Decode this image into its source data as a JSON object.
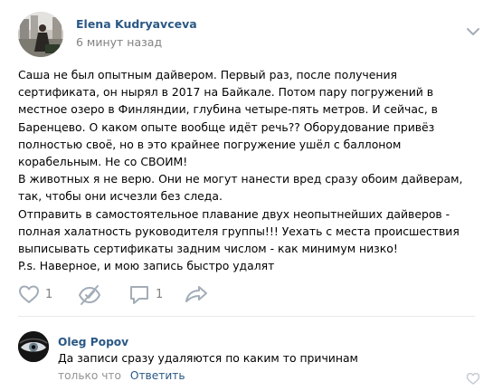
{
  "post": {
    "author": "Elena Kudryavceva",
    "time": "6 минут назад",
    "paragraphs": [
      "Саша не был опытным дайвером. Первый раз, после получения сертификата, он нырял в 2017 на Байкале. Потом пару погружений в местное озеро в Финляндии, глубина четыре-пять метров. И сейчас, в Баренцево. О каком опыте вообще идёт речь?? Оборудование привёз полностью своё, но в это крайнее погружение ушёл с баллоном корабельным. Не со СВОИМ!",
      "В животных я не верю. Они не могут нанести вред сразу обоим дайверам, так, чтобы они исчезли без следа.",
      "Отправить в самостоятельное плавание двух неопытнейших дайверов - полная халатность руководителя группы!!! Уехать с места происшествия выписывать сертификаты задним числом - как минимум низко!",
      "P.s. Наверное, и мою запись быстро удалят"
    ],
    "likes": "1",
    "comments": "1"
  },
  "comment": {
    "author": "Oleg Popov",
    "text": "Да записи сразу удаляются по каким то причинам",
    "time": "только что",
    "reply_label": "Ответить"
  },
  "icons": {
    "more": "chevron-down-icon",
    "like": "heart-outline-icon",
    "views": "eye-crossed-icon",
    "comment": "speech-bubble-icon",
    "share": "share-arrow-icon",
    "comment_like": "heart-outline-icon"
  },
  "colors": {
    "link": "#2a5885",
    "muted": "#828282",
    "icon": "#a3adb8",
    "divider": "#e7e8ec"
  }
}
